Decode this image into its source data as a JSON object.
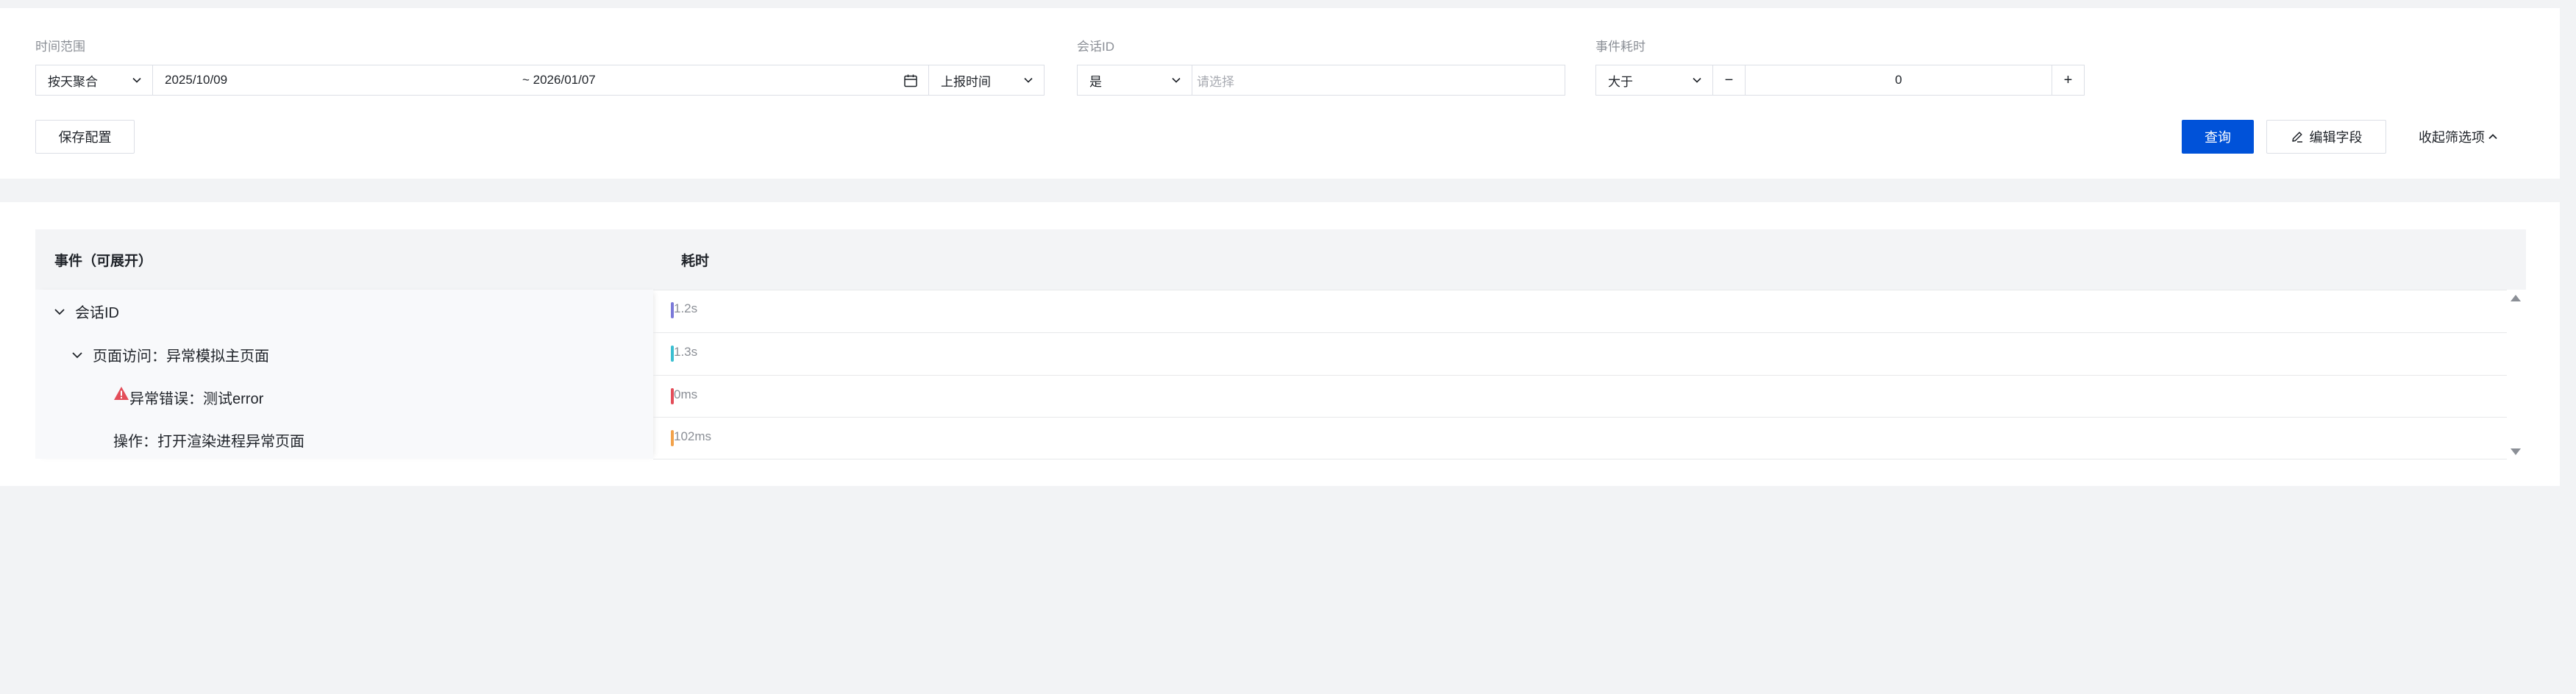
{
  "filters": {
    "time_range": {
      "label": "时间范围",
      "aggregation": "按天聚合",
      "start_date": "2025/10/09",
      "end_date": "~ 2026/01/07",
      "time_type": "上报时间"
    },
    "session_id": {
      "label": "会话ID",
      "operator": "是",
      "placeholder": "请选择"
    },
    "duration": {
      "label": "事件耗时",
      "operator": "大于",
      "minus": "−",
      "value": "0",
      "plus": "+"
    },
    "save_config": "保存配置",
    "query": "查询",
    "edit_fields": "编辑字段",
    "collapse_filters": "收起筛选项"
  },
  "table": {
    "columns": [
      "事件（可展开）",
      "耗时"
    ],
    "rows": [
      {
        "label": "会话ID",
        "duration": "1.2s",
        "color": "#7b79d9",
        "level": 0,
        "expandable": true
      },
      {
        "label": "页面访问：异常模拟主页面",
        "duration": "1.3s",
        "color": "#3bbfd1",
        "level": 1,
        "expandable": true
      },
      {
        "label": "异常错误：测试error",
        "duration": "0ms",
        "color": "#e34d59",
        "level": 2,
        "icon": "warning-icon"
      },
      {
        "label": "操作：打开渲染进程异常页面",
        "duration": "102ms",
        "color": "#f2a24b",
        "level": 2
      }
    ]
  },
  "colors": {
    "primary": "#0052d9",
    "error": "#e34d59"
  }
}
